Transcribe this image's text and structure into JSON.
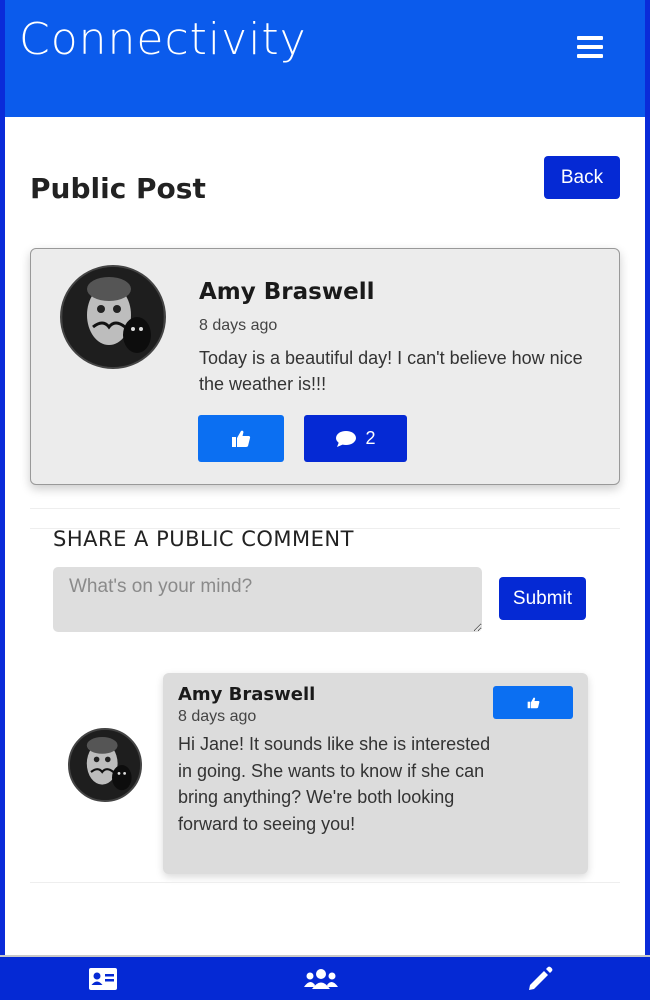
{
  "app": {
    "title": "Connectivity"
  },
  "page": {
    "title": "Public Post",
    "back_label": "Back"
  },
  "post": {
    "author": "Amy Braswell",
    "time": "8 days ago",
    "body": "Today is a beautiful day! I can't believe how nice the weather is!!!",
    "comment_count": "2"
  },
  "share": {
    "title": "SHARE A PUBLIC COMMENT",
    "placeholder": "What's on your mind?",
    "submit_label": "Submit"
  },
  "comments": [
    {
      "author": "Amy Braswell",
      "time": "8 days ago",
      "body": "Hi Jane! It sounds like she is interested in going. She wants to know if she can bring anything? We're both looking forward to seeing you!"
    }
  ],
  "nav": {
    "items": [
      {
        "icon": "id-card-icon"
      },
      {
        "icon": "users-icon"
      },
      {
        "icon": "pencil-icon"
      }
    ]
  },
  "colors": {
    "header": "#0b5bec",
    "primary": "#0529d4",
    "like": "#0b6ff2",
    "frame": "#0a2bd9"
  }
}
